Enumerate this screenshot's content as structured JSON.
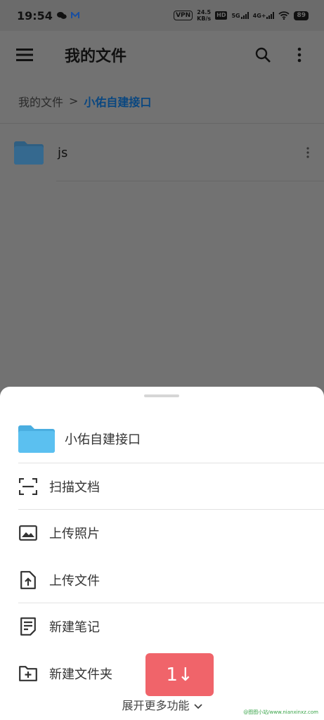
{
  "status_bar": {
    "time": "19:54",
    "vpn": "VPN",
    "speed_value": "24.5",
    "speed_unit": "KB/s",
    "hd": "HD",
    "net1": "5G",
    "net2": "4G+",
    "battery": "89"
  },
  "app_bar": {
    "title": "我的文件"
  },
  "breadcrumb": {
    "root": "我的文件",
    "separator": ">",
    "current": "小佑自建接口"
  },
  "files": [
    {
      "name": "js"
    }
  ],
  "sheet": {
    "folder_name": "小佑自建接口",
    "items": [
      {
        "label": "扫描文档",
        "icon": "scan-icon"
      },
      {
        "label": "上传照片",
        "icon": "image-icon"
      },
      {
        "label": "上传文件",
        "icon": "upload-file-icon"
      },
      {
        "label": "新建笔记",
        "icon": "note-icon"
      },
      {
        "label": "新建文件夹",
        "icon": "new-folder-icon"
      }
    ],
    "expand_label": "展开更多功能"
  },
  "float_button": {
    "label": "1↓"
  },
  "watermark": "@图图小站/www.nianxinxz.com",
  "colors": {
    "accent": "#0a4780",
    "folder": "#5bc0f0",
    "float_button": "#f0646a"
  }
}
